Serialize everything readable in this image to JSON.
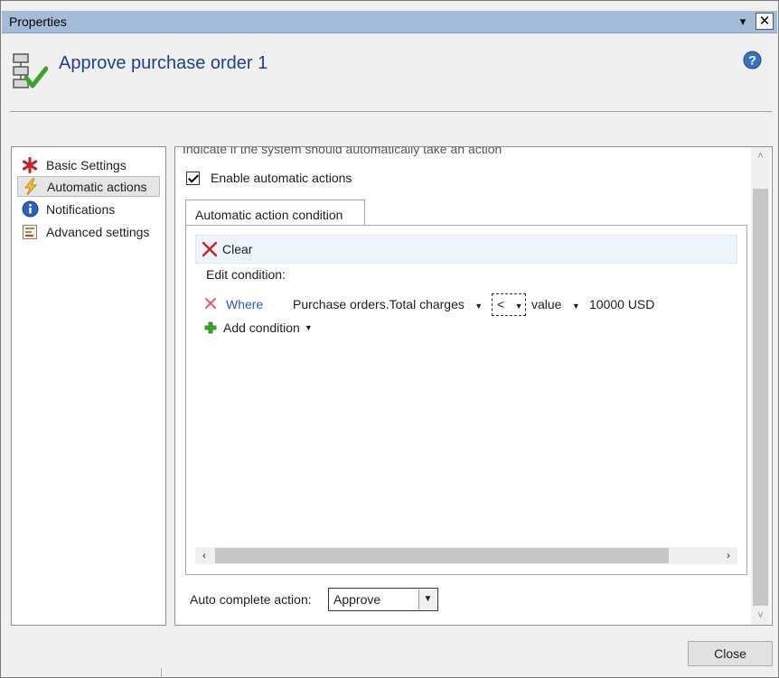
{
  "window": {
    "title": "Properties",
    "dropdown_glyph": "▾",
    "close_glyph": "✕"
  },
  "header": {
    "title": "Approve purchase order 1",
    "icon": "workflow-approve-icon",
    "help_icon": "help-icon"
  },
  "nav": {
    "items": [
      {
        "label": "Basic Settings",
        "icon": "asterisk-icon"
      },
      {
        "label": "Automatic actions",
        "icon": "lightning-icon",
        "selected": true
      },
      {
        "label": "Notifications",
        "icon": "info-icon"
      },
      {
        "label": "Advanced settings",
        "icon": "settings-form-icon"
      }
    ]
  },
  "content": {
    "clipped_text": "Indicate if the system should automatically take an action",
    "enable_label": "Enable automatic actions",
    "enable_checked": true,
    "tab_label": "Automatic action condition",
    "clear_label": "Clear",
    "edit_condition_label": "Edit condition:",
    "condition": {
      "where_label": "Where",
      "field": "Purchase orders.Total charges",
      "operator": "<",
      "value_type": "value",
      "value": "10000 USD"
    },
    "add_condition_label": "Add condition",
    "auto_complete_label": "Auto complete action:",
    "auto_complete_value": "Approve"
  },
  "footer": {
    "close_label": "Close"
  },
  "colors": {
    "titlebar": "#a4bcd9",
    "title_text": "#1f3f8f",
    "link": "#2b5bbf",
    "selected_nav": "#e5e5e5"
  }
}
